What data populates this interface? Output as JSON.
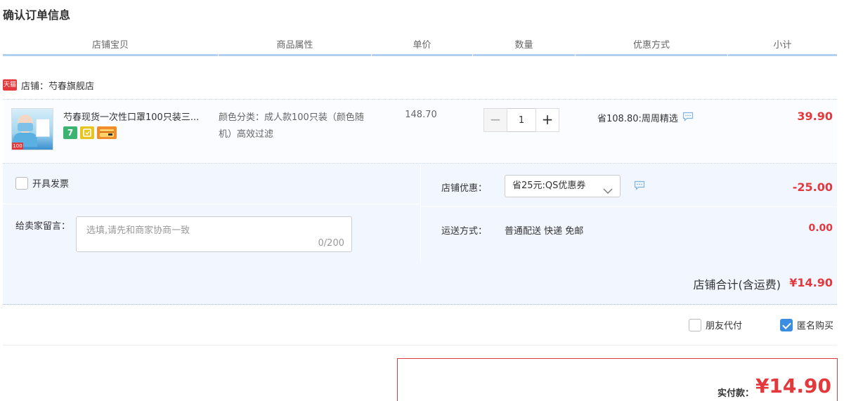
{
  "page": {
    "title": "确认订单信息"
  },
  "columns": [
    "店铺宝贝",
    "商品属性",
    "单价",
    "数量",
    "优惠方式",
    "小计"
  ],
  "shop": {
    "badge": "天猫",
    "name": "店铺：芍春旗舰店"
  },
  "item": {
    "title": "芍春现货一次性口罩100只装三...",
    "thumb_tag": "100",
    "attributes": "颜色分类：成人款100只装（颜色随机）高效过滤",
    "unit_price": "148.70",
    "quantity": "1",
    "qty_minus": "−",
    "qty_plus": "+",
    "promotion": "省108.80:周周精选",
    "subtotal": "39.90",
    "service_icons": [
      {
        "icon": "seven-day-return-icon",
        "text": "7"
      },
      {
        "icon": "shipping-insurance-icon",
        "text": ""
      },
      {
        "icon": "credit-card-icon",
        "text": ""
      }
    ]
  },
  "invoice": {
    "label": "开具发票",
    "checked": false
  },
  "message": {
    "label": "给卖家留言：",
    "placeholder": "选填,请先和商家协商一致",
    "counter": "0/200"
  },
  "coupon": {
    "label": "店铺优惠：",
    "selected": "省25元:QS优惠券",
    "amount": "-25.00"
  },
  "shipping": {
    "label": "运送方式：",
    "method": "普通配送 快递 免邮",
    "amount": "0.00"
  },
  "shop_total": {
    "label": "店铺合计(含运费)",
    "amount": "¥14.90"
  },
  "options": {
    "friend_pay": {
      "label": "朋友代付",
      "checked": false
    },
    "anonymous": {
      "label": "匿名购买",
      "checked": true
    }
  },
  "payment": {
    "label": "实付款：",
    "amount": "¥14.90"
  },
  "colors": {
    "accent_red": "#e4393c",
    "header_line": "#b2d1f0",
    "panel_bg": "#f2f7ff",
    "check_blue": "#3b8ddf"
  }
}
